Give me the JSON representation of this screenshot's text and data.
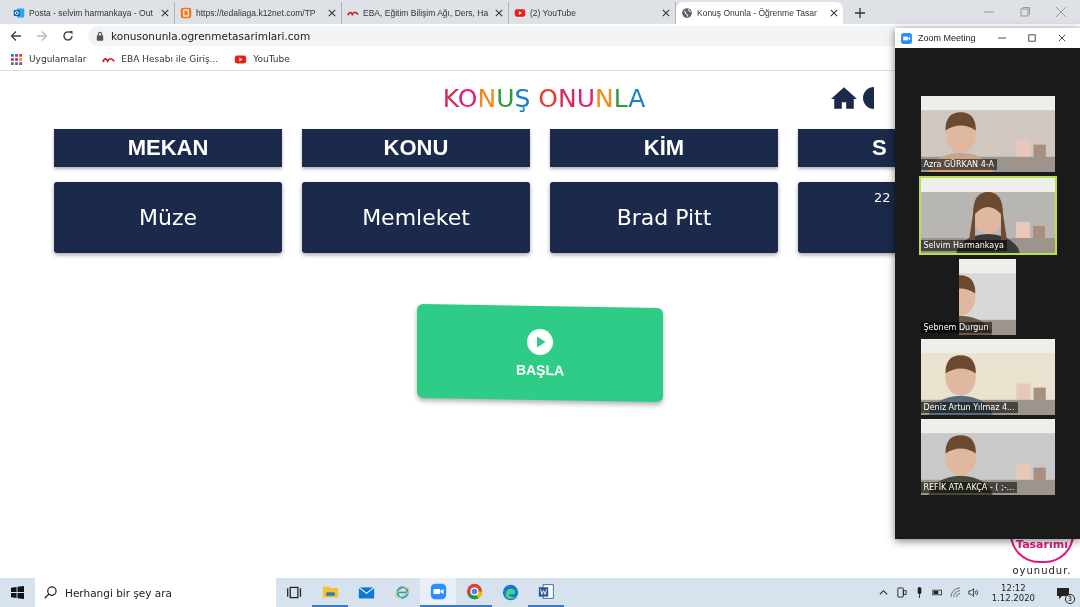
{
  "browser": {
    "tabs": [
      {
        "kind": "outlook",
        "title": "Posta - selvim harmankaya - Out",
        "selected": false
      },
      {
        "kind": "k12",
        "title": "https://tedaliaga.k12net.com/TP",
        "selected": false
      },
      {
        "kind": "eba",
        "title": "EBA, Eğitim Bilişim Ağı, Ders, Ha",
        "selected": false
      },
      {
        "kind": "youtube",
        "title": "(2) YouTube",
        "selected": false
      },
      {
        "kind": "globe",
        "title": "Konuş Onunla - Öğrenme Tasar",
        "selected": true
      }
    ],
    "address": "konusonunla.ogrenmetasarimlari.com",
    "bookmarks": [
      {
        "kind": "apps",
        "label": "Uygulamalar"
      },
      {
        "kind": "eba",
        "label": "EBA Hesabı ile Giriş..."
      },
      {
        "kind": "youtube",
        "label": "YouTube"
      }
    ]
  },
  "page": {
    "logo": "KONUŞ ONUNLA",
    "cards": [
      {
        "heading": "MEKAN",
        "value": "Müze"
      },
      {
        "heading": "KONU",
        "value": "Memleket"
      },
      {
        "heading": "KİM",
        "value": "Brad Pitt"
      },
      {
        "heading": "S",
        "value": "22"
      }
    ],
    "start_button": "BAŞLA",
    "badge_word": "Tasarımı",
    "badge_caption": "oyunudur."
  },
  "zoom": {
    "title": "Zoom Meeting",
    "participants": [
      {
        "name": "Azra GÜRKAN 4-A",
        "speaking": false,
        "narrow": false
      },
      {
        "name": "Selvim Harmankaya",
        "speaking": true,
        "narrow": false
      },
      {
        "name": "Şebnem Durgun",
        "speaking": false,
        "narrow": true
      },
      {
        "name": "Deniz Artun Yılmaz 4...",
        "speaking": false,
        "narrow": false
      },
      {
        "name": "REFİK ATA AKÇA - ( ;-...",
        "speaking": false,
        "narrow": false
      }
    ]
  },
  "taskbar": {
    "search": {
      "placeholder": "Herhangi bir şey ara"
    },
    "apps": [
      {
        "kind": "taskview",
        "running": false,
        "selected": false
      },
      {
        "kind": "explorer",
        "running": true,
        "selected": false
      },
      {
        "kind": "mail",
        "running": false,
        "selected": false
      },
      {
        "kind": "ie",
        "running": false,
        "selected": false
      },
      {
        "kind": "zoom",
        "running": true,
        "selected": true
      },
      {
        "kind": "chrome",
        "running": true,
        "selected": false
      },
      {
        "kind": "edge",
        "running": false,
        "selected": false
      },
      {
        "kind": "word",
        "running": true,
        "selected": false
      }
    ],
    "time": "12:12",
    "date": "1.12.2020",
    "notifications": "3"
  }
}
